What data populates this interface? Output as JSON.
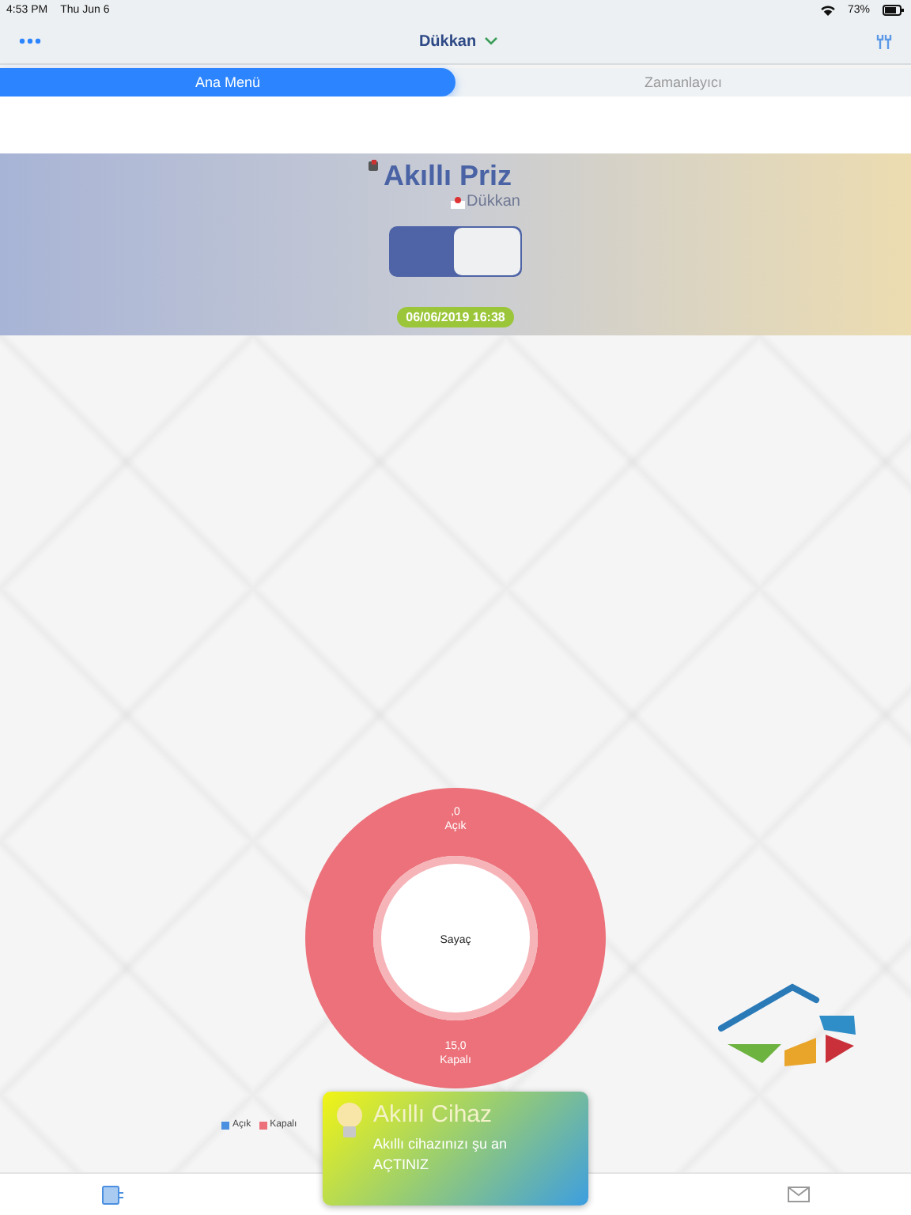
{
  "status_bar": {
    "time": "4:53 PM",
    "date": "Thu Jun 6",
    "battery": "73%"
  },
  "nav": {
    "title": "Dükkan"
  },
  "tabs": [
    {
      "label": "Ana Menü",
      "selected": true
    },
    {
      "label": "Zamanlayıcı",
      "selected": false
    }
  ],
  "device": {
    "name": "Akıllı Priz",
    "location": "Dükkan",
    "switch": {
      "on": true
    },
    "timestamp": "06/06/2019 16:38"
  },
  "chart": {
    "chart_data": {
      "type": "donut",
      "title": "Sayaç",
      "categories": [
        "Açık",
        "Kapalı"
      ],
      "values": [
        0,
        15
      ],
      "value_labels": [
        ",0",
        "15,0"
      ]
    }
  },
  "legend": [
    {
      "label": "Açık",
      "color": "#4a8fe0"
    },
    {
      "label": "Kapalı",
      "color": "#ec717a"
    }
  ],
  "toast": {
    "title": "Akıllı Cihaz",
    "message": "Akıllı cihazınızı şu an AÇTINIZ"
  }
}
